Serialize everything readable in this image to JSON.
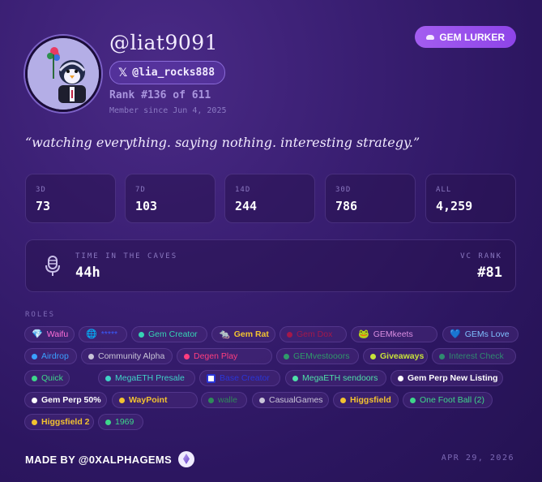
{
  "profile": {
    "username": "@liat9091",
    "x_handle": "@lia_rocks888",
    "x_icon": "𝕏",
    "rank": "Rank #136 of 611",
    "member_since": "Member since Jun 4, 2025",
    "badge": "GEM LURKER",
    "quote": "“watching everything. saying nothing. interesting strategy.”"
  },
  "stats": [
    {
      "label": "3D",
      "value": "73"
    },
    {
      "label": "7D",
      "value": "103"
    },
    {
      "label": "14D",
      "value": "244"
    },
    {
      "label": "30D",
      "value": "786"
    },
    {
      "label": "ALL",
      "value": "4,259"
    }
  ],
  "caves": {
    "label": "TIME IN THE CAVES",
    "value": "44h",
    "rank_label": "VC RANK",
    "rank_value": "#81"
  },
  "roles_label": "ROLES",
  "roles": [
    {
      "label": "Waifu",
      "color": "#ff6fd8",
      "icon": "diamond-icon"
    },
    {
      "label": "*****",
      "color": "#3a5cff",
      "icon": "orb-icon"
    },
    {
      "label": "Gem Creator",
      "color": "#36d3b4",
      "icon": "dot"
    },
    {
      "label": "Gem Rat",
      "color": "#f2c230",
      "icon": "rat-icon"
    },
    {
      "label": "Gem Dox",
      "color": "#a3184a",
      "icon": "dot"
    },
    {
      "label": "GEMkeets",
      "color": "#d98de0",
      "icon": "frog-icon"
    },
    {
      "label": "GEMs Love",
      "color": "#7fc0ff",
      "icon": "heart-icon"
    },
    {
      "label": "Airdrop",
      "color": "#3aa0ff",
      "icon": "dot"
    },
    {
      "label": "Community Alpha",
      "color": "#c9c4d8",
      "icon": "dot"
    },
    {
      "label": "Degen Play",
      "color": "#ff3d7f",
      "icon": "dot"
    },
    {
      "label": "GEMvestooors",
      "color": "#2f9a6a",
      "icon": "dot"
    },
    {
      "label": "Giveaways",
      "color": "#c7e23a",
      "icon": "dot"
    },
    {
      "label": "Interest Check",
      "color": "#2f8a70",
      "icon": "dot"
    },
    {
      "label": "Quick",
      "color": "#3ed68a",
      "icon": "dot"
    },
    {
      "label": "MegaETH Presale",
      "color": "#3fd3c8",
      "icon": "dot"
    },
    {
      "label": "Base Creator",
      "color": "#2a35d8",
      "icon": "square-icon"
    },
    {
      "label": "MegaETH sendoors",
      "color": "#4fe0a8",
      "icon": "dot"
    },
    {
      "label": "Gem Perp New Listing",
      "color": "#ffffff",
      "icon": "dot"
    },
    {
      "label": "Gem Perp 50%",
      "color": "#ffffff",
      "icon": "dot"
    },
    {
      "label": "WayPoint",
      "color": "#f2c230",
      "icon": "dot"
    },
    {
      "label": "walle",
      "color": "#2f8a5a",
      "icon": "dot"
    },
    {
      "label": "CasualGames",
      "color": "#c9c4d8",
      "icon": "dot"
    },
    {
      "label": "Higgsfield",
      "color": "#f2c230",
      "icon": "dot"
    },
    {
      "label": "One Foot Ball (2)",
      "color": "#3ed68a",
      "icon": "dot"
    },
    {
      "label": "Higgsfield 2",
      "color": "#f2c230",
      "icon": "dot"
    },
    {
      "label": "1969",
      "color": "#3ed68a",
      "icon": "dot"
    }
  ],
  "footer": {
    "made_by": "MADE BY @0XALPHAGEMS",
    "date": "APR 29, 2026"
  }
}
